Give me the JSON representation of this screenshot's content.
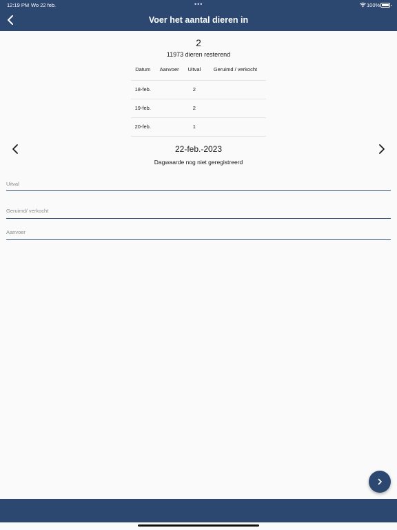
{
  "status_bar": {
    "time": "12:19 PM",
    "date": "Wo 22 feb.",
    "dots": "•••",
    "battery": "100%"
  },
  "header": {
    "title": "Voer het aantal dieren in",
    "back_icon": "chevron-left-icon"
  },
  "summary": {
    "count": "2",
    "remaining": "11973 dieren resterend"
  },
  "history_table": {
    "columns": [
      "Datum",
      "Aanvoer",
      "Uitval",
      "Geruimd / verkocht"
    ],
    "rows": [
      {
        "date": "18-feb.",
        "aanvoer": "",
        "uitval": "2",
        "geruimd": ""
      },
      {
        "date": "19-feb.",
        "aanvoer": "",
        "uitval": "2",
        "geruimd": ""
      },
      {
        "date": "20-feb.",
        "aanvoer": "",
        "uitval": "1",
        "geruimd": ""
      }
    ]
  },
  "day_nav": {
    "date": "22-feb.-2023",
    "status": "Dagwaarde nog niet geregistreerd",
    "prev_icon": "chevron-left-icon",
    "next_icon": "chevron-right-icon"
  },
  "form": {
    "uitval": {
      "placeholder": "Uitval",
      "value": ""
    },
    "geruimd": {
      "placeholder": "Geruimd/ verkocht",
      "value": ""
    },
    "aanvoer": {
      "placeholder": "Aanvoer",
      "value": ""
    }
  },
  "fab": {
    "icon": "chevron-right-icon"
  },
  "colors": {
    "primary": "#2c4770",
    "background": "#fafafa",
    "divider": "#e3e3e3"
  }
}
